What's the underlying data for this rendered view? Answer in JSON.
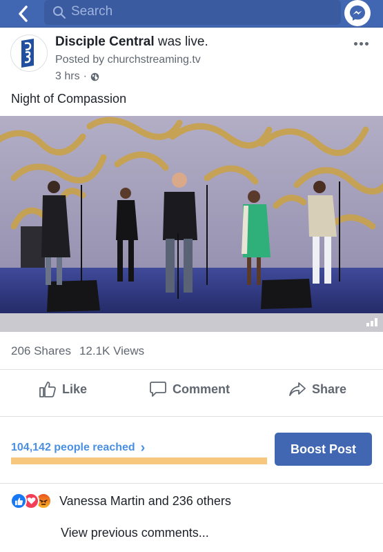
{
  "topbar": {
    "search_placeholder": "Search",
    "color": "#4267b2"
  },
  "post": {
    "page_name": "Disciple Central",
    "action_text": " was live.",
    "posted_by": "Posted by churchstreaming.tv",
    "time": "3 hrs",
    "time_separator": "·",
    "audience_icon": "globe-icon",
    "text": "Night of Compassion"
  },
  "stats": {
    "shares": "206 Shares",
    "views": "12.1K Views"
  },
  "actions": {
    "like": "Like",
    "comment": "Comment",
    "share": "Share"
  },
  "insights": {
    "reached": "104,142 people reached",
    "reach_chevron": "›",
    "boost_label": "Boost Post",
    "bar_color": "#f6c77c"
  },
  "reactions": {
    "icons": [
      "like-icon",
      "love-icon",
      "angry-icon"
    ],
    "summary": "Vanessa Martin and 236 others"
  },
  "comments": {
    "view_previous": "View previous comments..."
  }
}
